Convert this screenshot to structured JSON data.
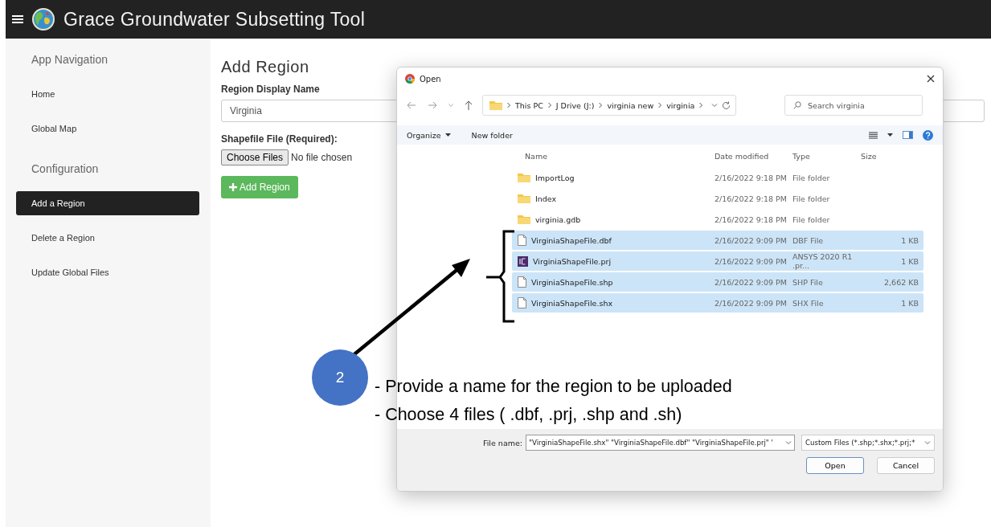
{
  "app": {
    "title": "Grace Groundwater Subsetting Tool"
  },
  "sidebar": {
    "sections": [
      {
        "heading": "App Navigation",
        "items": [
          {
            "label": "Home",
            "selected": false
          },
          {
            "label": "Global Map",
            "selected": false
          }
        ]
      },
      {
        "heading": "Configuration",
        "items": [
          {
            "label": "Add a Region",
            "selected": true
          },
          {
            "label": "Delete a Region",
            "selected": false
          },
          {
            "label": "Update Global Files",
            "selected": false
          }
        ]
      }
    ]
  },
  "form": {
    "title": "Add Region",
    "name_label": "Region Display Name",
    "name_value": "Virginia",
    "file_label": "Shapefile File (Required):",
    "choose_button": "Choose Files",
    "file_status": "No file chosen",
    "submit_button": "Add Region"
  },
  "dialog": {
    "title": "Open",
    "breadcrumb": [
      "This PC",
      "J Drive (J:)",
      "virginia new",
      "virginia"
    ],
    "search_placeholder": "Search virginia",
    "toolbar": [
      "Organize",
      "New folder"
    ],
    "columns": [
      "Name",
      "Date modified",
      "Type",
      "Size"
    ],
    "files": [
      {
        "name": "ImportLog",
        "date": "2/16/2022 9:18 PM",
        "type": "File folder",
        "kind": "folder",
        "selected": false
      },
      {
        "name": "Index",
        "date": "2/16/2022 9:18 PM",
        "type": "File folder",
        "kind": "folder",
        "selected": false
      },
      {
        "name": "virginia.gdb",
        "date": "2/16/2022 9:18 PM",
        "type": "File folder",
        "kind": "folder",
        "selected": false
      },
      {
        "name": "VirginiaShapeFile.dbf",
        "date": "2/16/2022 9:09 PM",
        "type": "DBF File",
        "size": "1 KB",
        "kind": "file",
        "selected": true
      },
      {
        "name": "VirginiaShapeFile.prj",
        "date": "2/16/2022 9:09 PM",
        "type": "ANSYS 2020 R1 .pr...",
        "size": "1 KB",
        "kind": "app",
        "selected": true
      },
      {
        "name": "VirginiaShapeFile.shp",
        "date": "2/16/2022 9:09 PM",
        "type": "SHP File",
        "size": "2,662 KB",
        "kind": "file",
        "selected": true
      },
      {
        "name": "VirginiaShapeFile.shx",
        "date": "2/16/2022 9:09 PM",
        "type": "SHX File",
        "size": "1 KB",
        "kind": "file",
        "selected": true
      }
    ],
    "file_name_label": "File name:",
    "file_name_value": "\"VirginiaShapeFile.shx\" \"VirginiaShapeFile.dbf\" \"VirginiaShapeFile.prj\" '",
    "filter": "Custom Files (*.shp;*.shx;*.prj;*",
    "buttons": [
      "Open",
      "Cancel"
    ]
  },
  "annotation": {
    "step": "2",
    "lines": [
      "- Provide a name for the region to be uploaded",
      "- Choose  4 files ( .dbf, .prj, .shp and .sh)"
    ]
  }
}
